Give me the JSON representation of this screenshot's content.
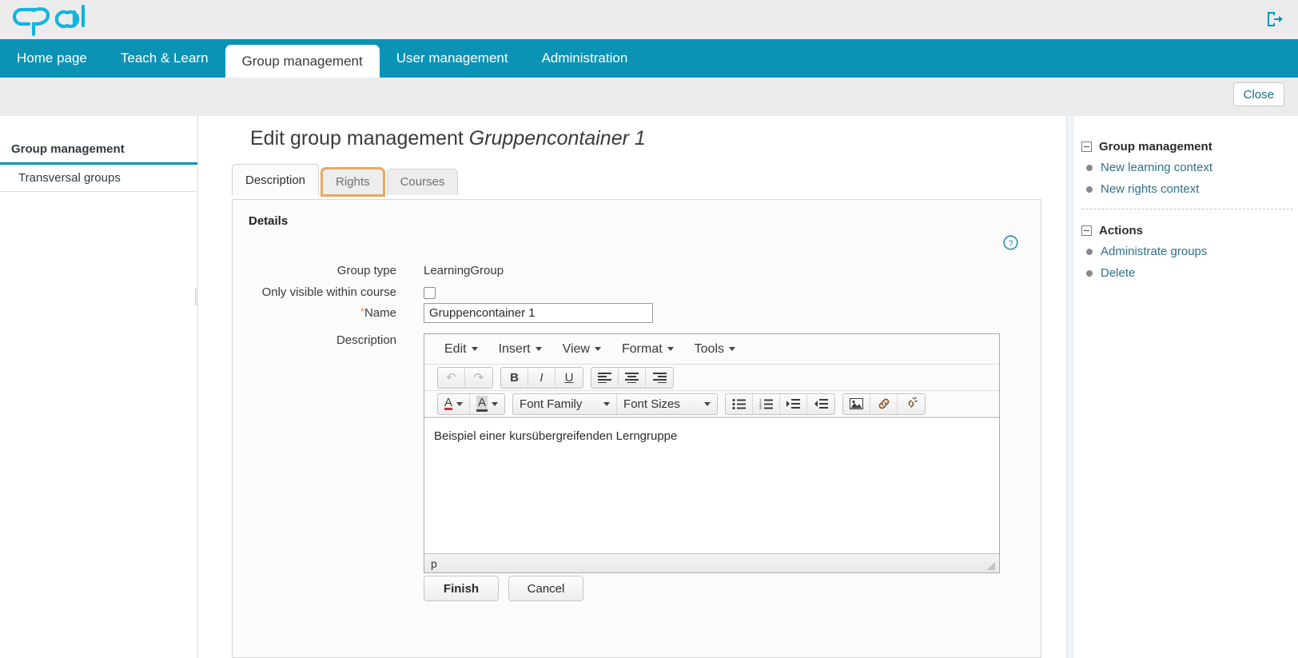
{
  "header": {
    "logo_text": "Opal",
    "logout_icon": "logout-icon",
    "close_label": "Close"
  },
  "nav": {
    "items": [
      {
        "label": "Home page",
        "active": false
      },
      {
        "label": "Teach & Learn",
        "active": false
      },
      {
        "label": "Group management",
        "active": true
      },
      {
        "label": "User management",
        "active": false
      },
      {
        "label": "Administration",
        "active": false
      }
    ]
  },
  "sidebar": {
    "items": [
      {
        "label": "Group management",
        "active": true
      },
      {
        "label": "Transversal groups",
        "active": false
      }
    ]
  },
  "main": {
    "title_prefix": "Edit group management",
    "title_entity": "Gruppencontainer 1",
    "tabs": [
      {
        "label": "Description",
        "state": "active"
      },
      {
        "label": "Rights",
        "state": "focused"
      },
      {
        "label": "Courses",
        "state": "normal"
      }
    ],
    "section_title": "Details",
    "help_icon": "help-icon",
    "fields": {
      "group_type_label": "Group type",
      "group_type_value": "LearningGroup",
      "only_visible_label": "Only visible within course",
      "only_visible_checked": false,
      "name_label": "Name",
      "name_required_marker": "*",
      "name_value": "Gruppencontainer 1",
      "name_placeholder": "",
      "description_label": "Description"
    },
    "editor": {
      "menus": [
        "Edit",
        "Insert",
        "View",
        "Format",
        "Tools"
      ],
      "toolbar_row1": [
        {
          "name": "undo-icon",
          "glyph": "↶",
          "disabled": true
        },
        {
          "name": "redo-icon",
          "glyph": "↷",
          "disabled": true
        },
        {
          "name": "bold-icon",
          "glyph": "B",
          "disabled": false
        },
        {
          "name": "italic-icon",
          "glyph": "I",
          "disabled": false
        },
        {
          "name": "underline-icon",
          "glyph": "U",
          "disabled": false
        },
        {
          "name": "align-left-icon",
          "glyph": "☰",
          "disabled": false
        },
        {
          "name": "align-center-icon",
          "glyph": "☰",
          "disabled": false
        },
        {
          "name": "align-right-icon",
          "glyph": "☰",
          "disabled": false
        }
      ],
      "toolbar_row2": [
        {
          "name": "text-color-icon",
          "glyph": "A"
        },
        {
          "name": "background-color-icon",
          "glyph": "A"
        },
        {
          "name": "font-family-select",
          "glyph": "Font Family"
        },
        {
          "name": "font-sizes-select",
          "glyph": "Font Sizes"
        },
        {
          "name": "bullet-list-icon",
          "glyph": "☰"
        },
        {
          "name": "numbered-list-icon",
          "glyph": "☰"
        },
        {
          "name": "increase-indent-icon",
          "glyph": "☰"
        },
        {
          "name": "decrease-indent-icon",
          "glyph": "☰"
        },
        {
          "name": "insert-image-icon",
          "glyph": "Ὓc"
        },
        {
          "name": "insert-link-icon",
          "glyph": "ὑ7"
        },
        {
          "name": "unlink-icon",
          "glyph": "ὑ7"
        }
      ],
      "font_family_label": "Font Family",
      "font_sizes_label": "Font Sizes",
      "content": "Beispiel einer kursübergreifenden Lerngruppe",
      "statusbar_path": "p"
    },
    "actions": {
      "finish_label": "Finish",
      "cancel_label": "Cancel"
    }
  },
  "rightpanel": {
    "groups": [
      {
        "title": "Group management",
        "links": [
          "New learning context",
          "New rights context"
        ]
      },
      {
        "title": "Actions",
        "links": [
          "Administrate groups",
          "Delete"
        ]
      }
    ]
  },
  "colors": {
    "brand": "#0b93b5",
    "accent_orange": "#e8a661",
    "link": "#2f6f87"
  }
}
